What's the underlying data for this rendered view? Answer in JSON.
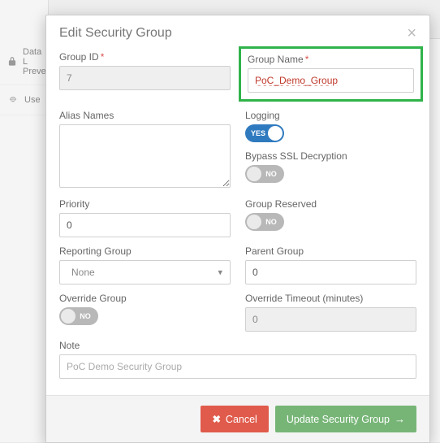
{
  "bg": {
    "item1": "Data L",
    "item1b": "Preve",
    "item2": "Use"
  },
  "modal": {
    "title": "Edit Security Group",
    "fields": {
      "group_id": {
        "label": "Group ID",
        "value": "7"
      },
      "group_name": {
        "label": "Group Name",
        "value": "PoC_Demo_Group"
      },
      "alias_names": {
        "label": "Alias Names",
        "value": ""
      },
      "logging": {
        "label": "Logging",
        "state": "YES"
      },
      "bypass_ssl": {
        "label": "Bypass SSL Decryption",
        "state": "NO"
      },
      "priority": {
        "label": "Priority",
        "value": "0"
      },
      "group_reserved": {
        "label": "Group Reserved",
        "state": "NO"
      },
      "reporting_group": {
        "label": "Reporting Group",
        "value": "None"
      },
      "parent_group": {
        "label": "Parent Group",
        "value": "0"
      },
      "override_group": {
        "label": "Override Group",
        "state": "NO"
      },
      "override_timeout": {
        "label": "Override Timeout (minutes)",
        "value": "0"
      },
      "note": {
        "label": "Note",
        "value": "PoC Demo Security Group"
      }
    },
    "buttons": {
      "cancel": "Cancel",
      "submit": "Update Security Group"
    }
  }
}
